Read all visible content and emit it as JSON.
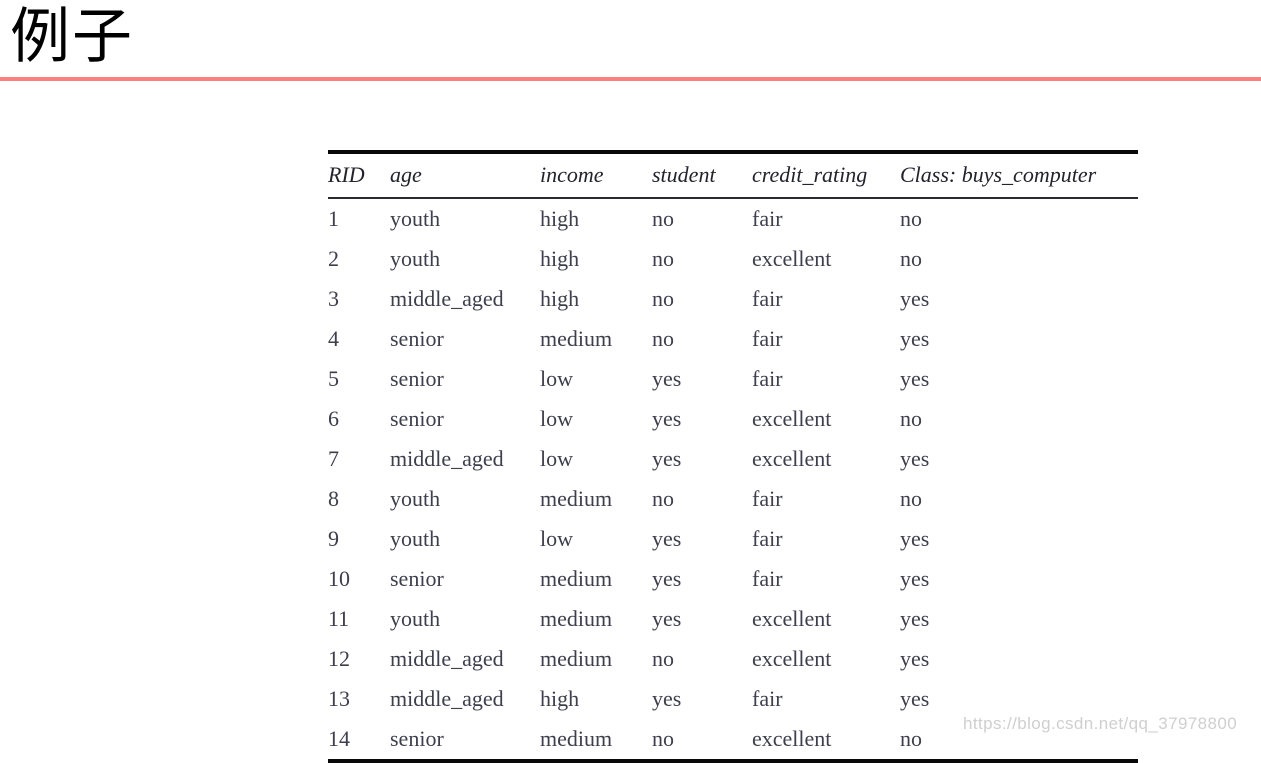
{
  "slide": {
    "title": "例子",
    "accent_color": "#fa8080",
    "background_color": "#ffffff",
    "text_color": "#3e3e4c"
  },
  "watermark": {
    "text": "https://blog.csdn.net/qq_37978800"
  },
  "table": {
    "columns": [
      {
        "key": "rid",
        "label": "RID"
      },
      {
        "key": "age",
        "label": "age"
      },
      {
        "key": "income",
        "label": "income"
      },
      {
        "key": "student",
        "label": "student"
      },
      {
        "key": "credit",
        "label": "credit_rating"
      },
      {
        "key": "class",
        "label": "Class: buys_computer"
      }
    ],
    "rows": [
      {
        "rid": "1",
        "age": "youth",
        "income": "high",
        "student": "no",
        "credit": "fair",
        "class": "no"
      },
      {
        "rid": "2",
        "age": "youth",
        "income": "high",
        "student": "no",
        "credit": "excellent",
        "class": "no"
      },
      {
        "rid": "3",
        "age": "middle_aged",
        "income": "high",
        "student": "no",
        "credit": "fair",
        "class": "yes"
      },
      {
        "rid": "4",
        "age": "senior",
        "income": "medium",
        "student": "no",
        "credit": "fair",
        "class": "yes"
      },
      {
        "rid": "5",
        "age": "senior",
        "income": "low",
        "student": "yes",
        "credit": "fair",
        "class": "yes"
      },
      {
        "rid": "6",
        "age": "senior",
        "income": "low",
        "student": "yes",
        "credit": "excellent",
        "class": "no"
      },
      {
        "rid": "7",
        "age": "middle_aged",
        "income": "low",
        "student": "yes",
        "credit": "excellent",
        "class": "yes"
      },
      {
        "rid": "8",
        "age": "youth",
        "income": "medium",
        "student": "no",
        "credit": "fair",
        "class": "no"
      },
      {
        "rid": "9",
        "age": "youth",
        "income": "low",
        "student": "yes",
        "credit": "fair",
        "class": "yes"
      },
      {
        "rid": "10",
        "age": "senior",
        "income": "medium",
        "student": "yes",
        "credit": "fair",
        "class": "yes"
      },
      {
        "rid": "11",
        "age": "youth",
        "income": "medium",
        "student": "yes",
        "credit": "excellent",
        "class": "yes"
      },
      {
        "rid": "12",
        "age": "middle_aged",
        "income": "medium",
        "student": "no",
        "credit": "excellent",
        "class": "yes"
      },
      {
        "rid": "13",
        "age": "middle_aged",
        "income": "high",
        "student": "yes",
        "credit": "fair",
        "class": "yes"
      },
      {
        "rid": "14",
        "age": "senior",
        "income": "medium",
        "student": "no",
        "credit": "excellent",
        "class": "no"
      }
    ]
  }
}
